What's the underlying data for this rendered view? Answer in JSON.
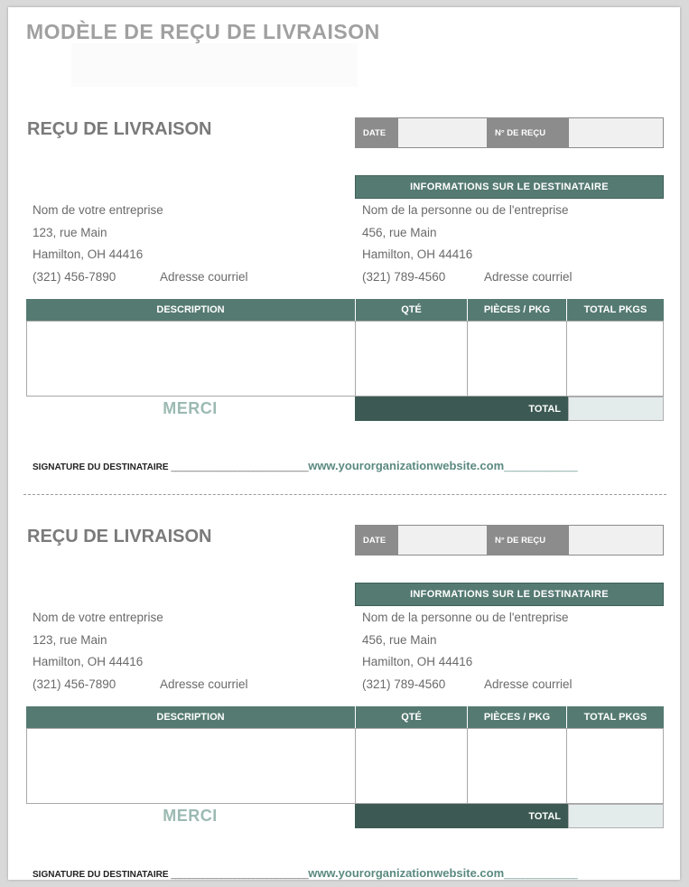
{
  "document_title": "MODÈLE DE REÇU DE LIVRAISON",
  "receipts": [
    {
      "title": "REÇU DE LIVRAISON",
      "date_label": "DATE",
      "receipt_no_label": "N° DE REÇU",
      "recipient_header": "INFORMATIONS SUR LE DESTINATAIRE",
      "sender": {
        "company": "Nom de votre entreprise",
        "street": "123, rue Main",
        "city": "Hamilton, OH 44416",
        "phone": "(321) 456-7890",
        "email": "Adresse courriel"
      },
      "recipient": {
        "name": "Nom de la personne ou de l'entreprise",
        "street": "456, rue Main",
        "city": "Hamilton, OH 44416",
        "phone": "(321) 789-4560",
        "email": "Adresse courriel"
      },
      "columns": [
        "DESCRIPTION",
        "QTÉ",
        "PIÈCES / PKG",
        "TOTAL PKGS"
      ],
      "merci": "MERCI",
      "total_label": "TOTAL",
      "signature_label": "SIGNATURE DU DESTINATAIRE",
      "signature_line": "______________________________",
      "website": "www.yourorganizationwebsite.com",
      "website_line": "________________"
    },
    {
      "title": "REÇU DE LIVRAISON",
      "date_label": "DATE",
      "receipt_no_label": "N° DE REÇU",
      "recipient_header": "INFORMATIONS SUR LE DESTINATAIRE",
      "sender": {
        "company": "Nom de votre entreprise",
        "street": "123, rue Main",
        "city": "Hamilton, OH 44416",
        "phone": "(321) 456-7890",
        "email": "Adresse courriel"
      },
      "recipient": {
        "name": "Nom de la personne ou de l'entreprise",
        "street": "456, rue Main",
        "city": "Hamilton, OH 44416",
        "phone": "(321) 789-4560",
        "email": "Adresse courriel"
      },
      "columns": [
        "DESCRIPTION",
        "QTÉ",
        "PIÈCES / PKG",
        "TOTAL PKGS"
      ],
      "merci": "MERCI",
      "total_label": "TOTAL",
      "signature_label": "SIGNATURE DU DESTINATAIRE",
      "signature_line": "______________________________",
      "website": "www.yourorganizationwebsite.com",
      "website_line": "________________"
    }
  ],
  "colors": {
    "header_green": "#557a72",
    "total_dark_green": "#3c5a53",
    "merci_green": "#9bbab2",
    "label_gray": "#8c8c8c"
  }
}
